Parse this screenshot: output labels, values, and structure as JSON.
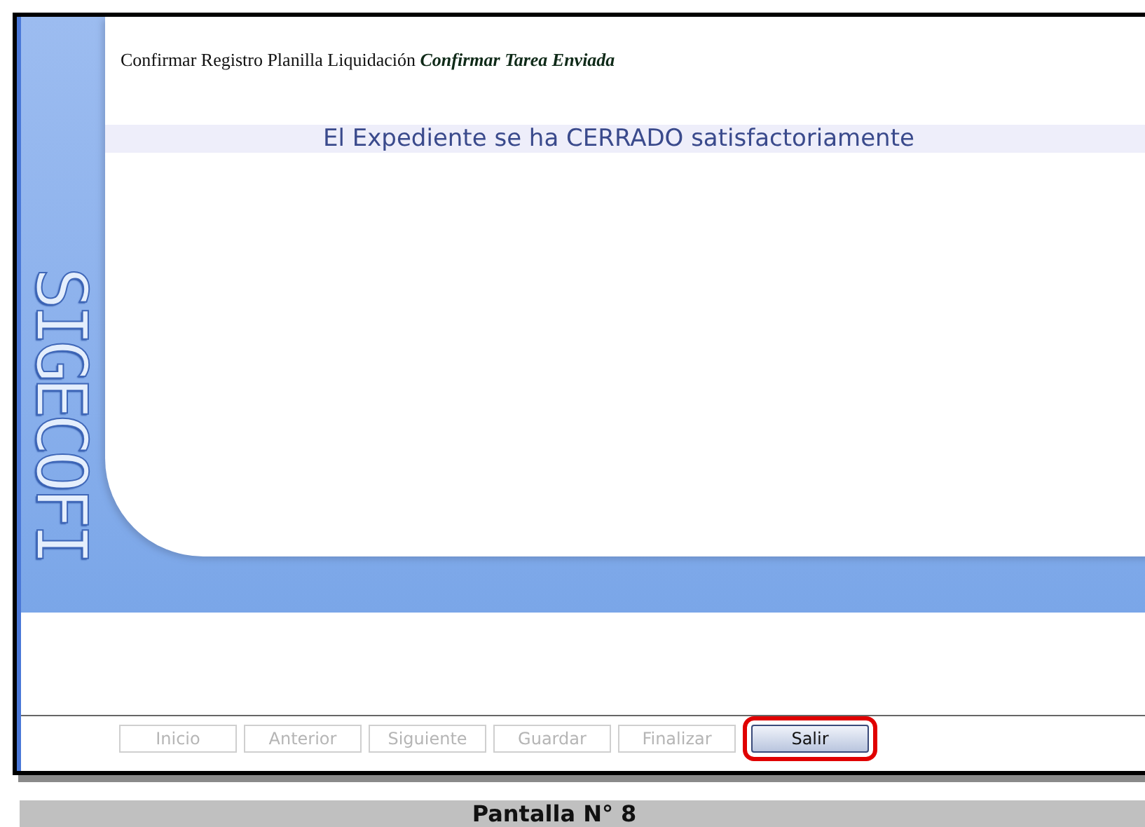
{
  "logo": {
    "text": "SIGECOFI"
  },
  "header": {
    "title": "Confirmar Registro Planilla Liquidación **Confirmar Tarea Enviada**"
  },
  "message": "El Expediente se ha CERRADO satisfactoriamente",
  "buttons": [
    {
      "label": "Inicio",
      "disabled": true,
      "highlighted": false
    },
    {
      "label": "Anterior",
      "disabled": true,
      "highlighted": false
    },
    {
      "label": "Siguiente",
      "disabled": true,
      "highlighted": false
    },
    {
      "label": "Guardar",
      "disabled": true,
      "highlighted": false
    },
    {
      "label": "Finalizar",
      "disabled": true,
      "highlighted": false
    },
    {
      "label": "Salir",
      "disabled": false,
      "highlighted": true
    }
  ],
  "caption": "Pantalla N° 8"
}
